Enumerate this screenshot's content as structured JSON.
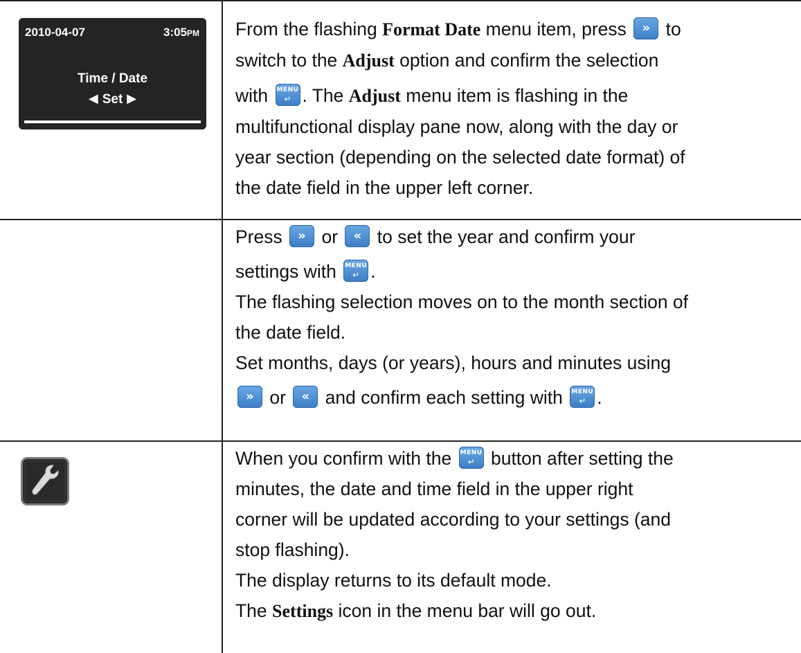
{
  "display": {
    "date": "2010-04-07",
    "time": "3:05",
    "time_suffix": "PM",
    "title": "Time / Date",
    "option": "Set"
  },
  "icons": {
    "next": "chevron-right-button",
    "prev": "chevron-left-button",
    "menu": "menu-enter-button",
    "settings": "wrench-icon"
  },
  "button_labels": {
    "menu": "MENU",
    "menu_enter": "↵",
    "next": "»",
    "prev": "«"
  },
  "colors": {
    "button_blue": "#4a8fd6",
    "display_bg": "#242424"
  },
  "row1": {
    "t1": "From the flashing ",
    "k1": "Format Date",
    "t2": " menu item, press ",
    "t3": " to",
    "t4": "switch to the ",
    "k2": "Adjust",
    "t5": " option and confirm the selection",
    "t6": "with ",
    "t7": ". The ",
    "k3": "Adjust",
    "t8": " menu item is flashing in the",
    "t9": "multifunctional display pane now, along with the day or",
    "t10": "year section (depending on the selected date format) of",
    "t11": "the date field in the upper left corner."
  },
  "row2": {
    "t1": "Press ",
    "t2": " or ",
    "t3": " to set the year and confirm your",
    "t4": "settings with ",
    "t5": ".",
    "t6": "The flashing selection moves on to the month section of",
    "t7": "the date field.",
    "t8": "Set months, days (or years), hours and minutes using",
    "t9": " or ",
    "t10": " and confirm each setting with ",
    "t11": "."
  },
  "row3": {
    "t1": "When you confirm with the ",
    "t2": " button after setting the",
    "t3": "minutes, the date and time field in the upper right",
    "t4": "corner will be updated according to your settings (and",
    "t5": "stop flashing).",
    "t6": "The display returns to its default mode.",
    "t7": "The ",
    "k1": "Settings",
    "t8": " icon in the menu bar will go out."
  }
}
